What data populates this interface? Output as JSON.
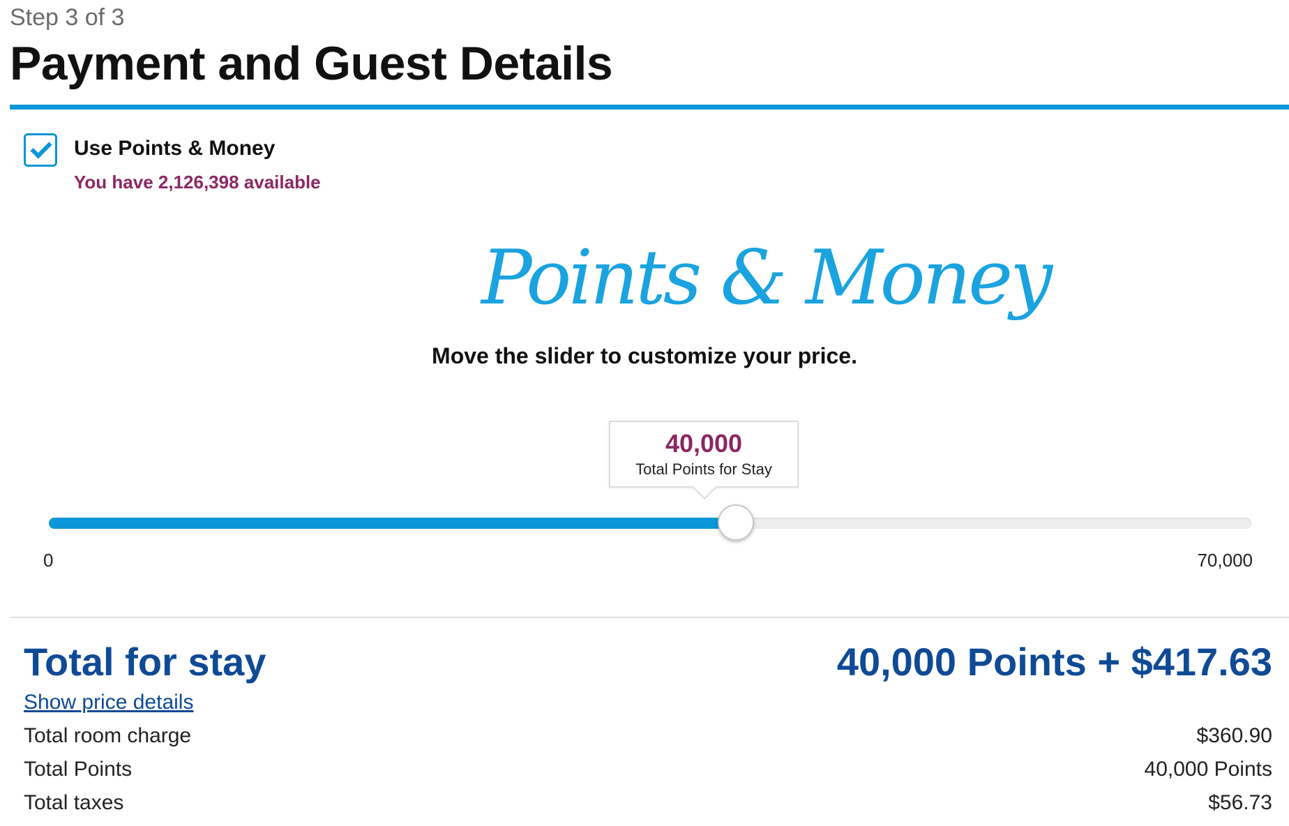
{
  "header": {
    "step": "Step 3 of 3",
    "title": "Payment and Guest Details"
  },
  "points_option": {
    "checked": true,
    "label": "Use Points & Money",
    "available_text": "You have 2,126,398 available"
  },
  "logo": {
    "text": "Points & Money"
  },
  "instructions": "Move the slider to customize your price.",
  "slider": {
    "value": 40000,
    "value_label": "40,000",
    "tooltip_label": "Total Points for Stay",
    "min": 0,
    "max": 70000,
    "min_label": "0",
    "max_label": "70,000"
  },
  "totals": {
    "label": "Total for stay",
    "value": "40,000 Points + $417.63",
    "details_link": "Show price details",
    "rows": [
      {
        "label": "Total room charge",
        "value": "$360.90"
      },
      {
        "label": "Total Points",
        "value": "40,000 Points"
      },
      {
        "label": "Total taxes",
        "value": "$56.73"
      }
    ]
  },
  "colors": {
    "accent_blue": "#0a96d9",
    "navy": "#0f4a96",
    "plum": "#8a2765"
  }
}
